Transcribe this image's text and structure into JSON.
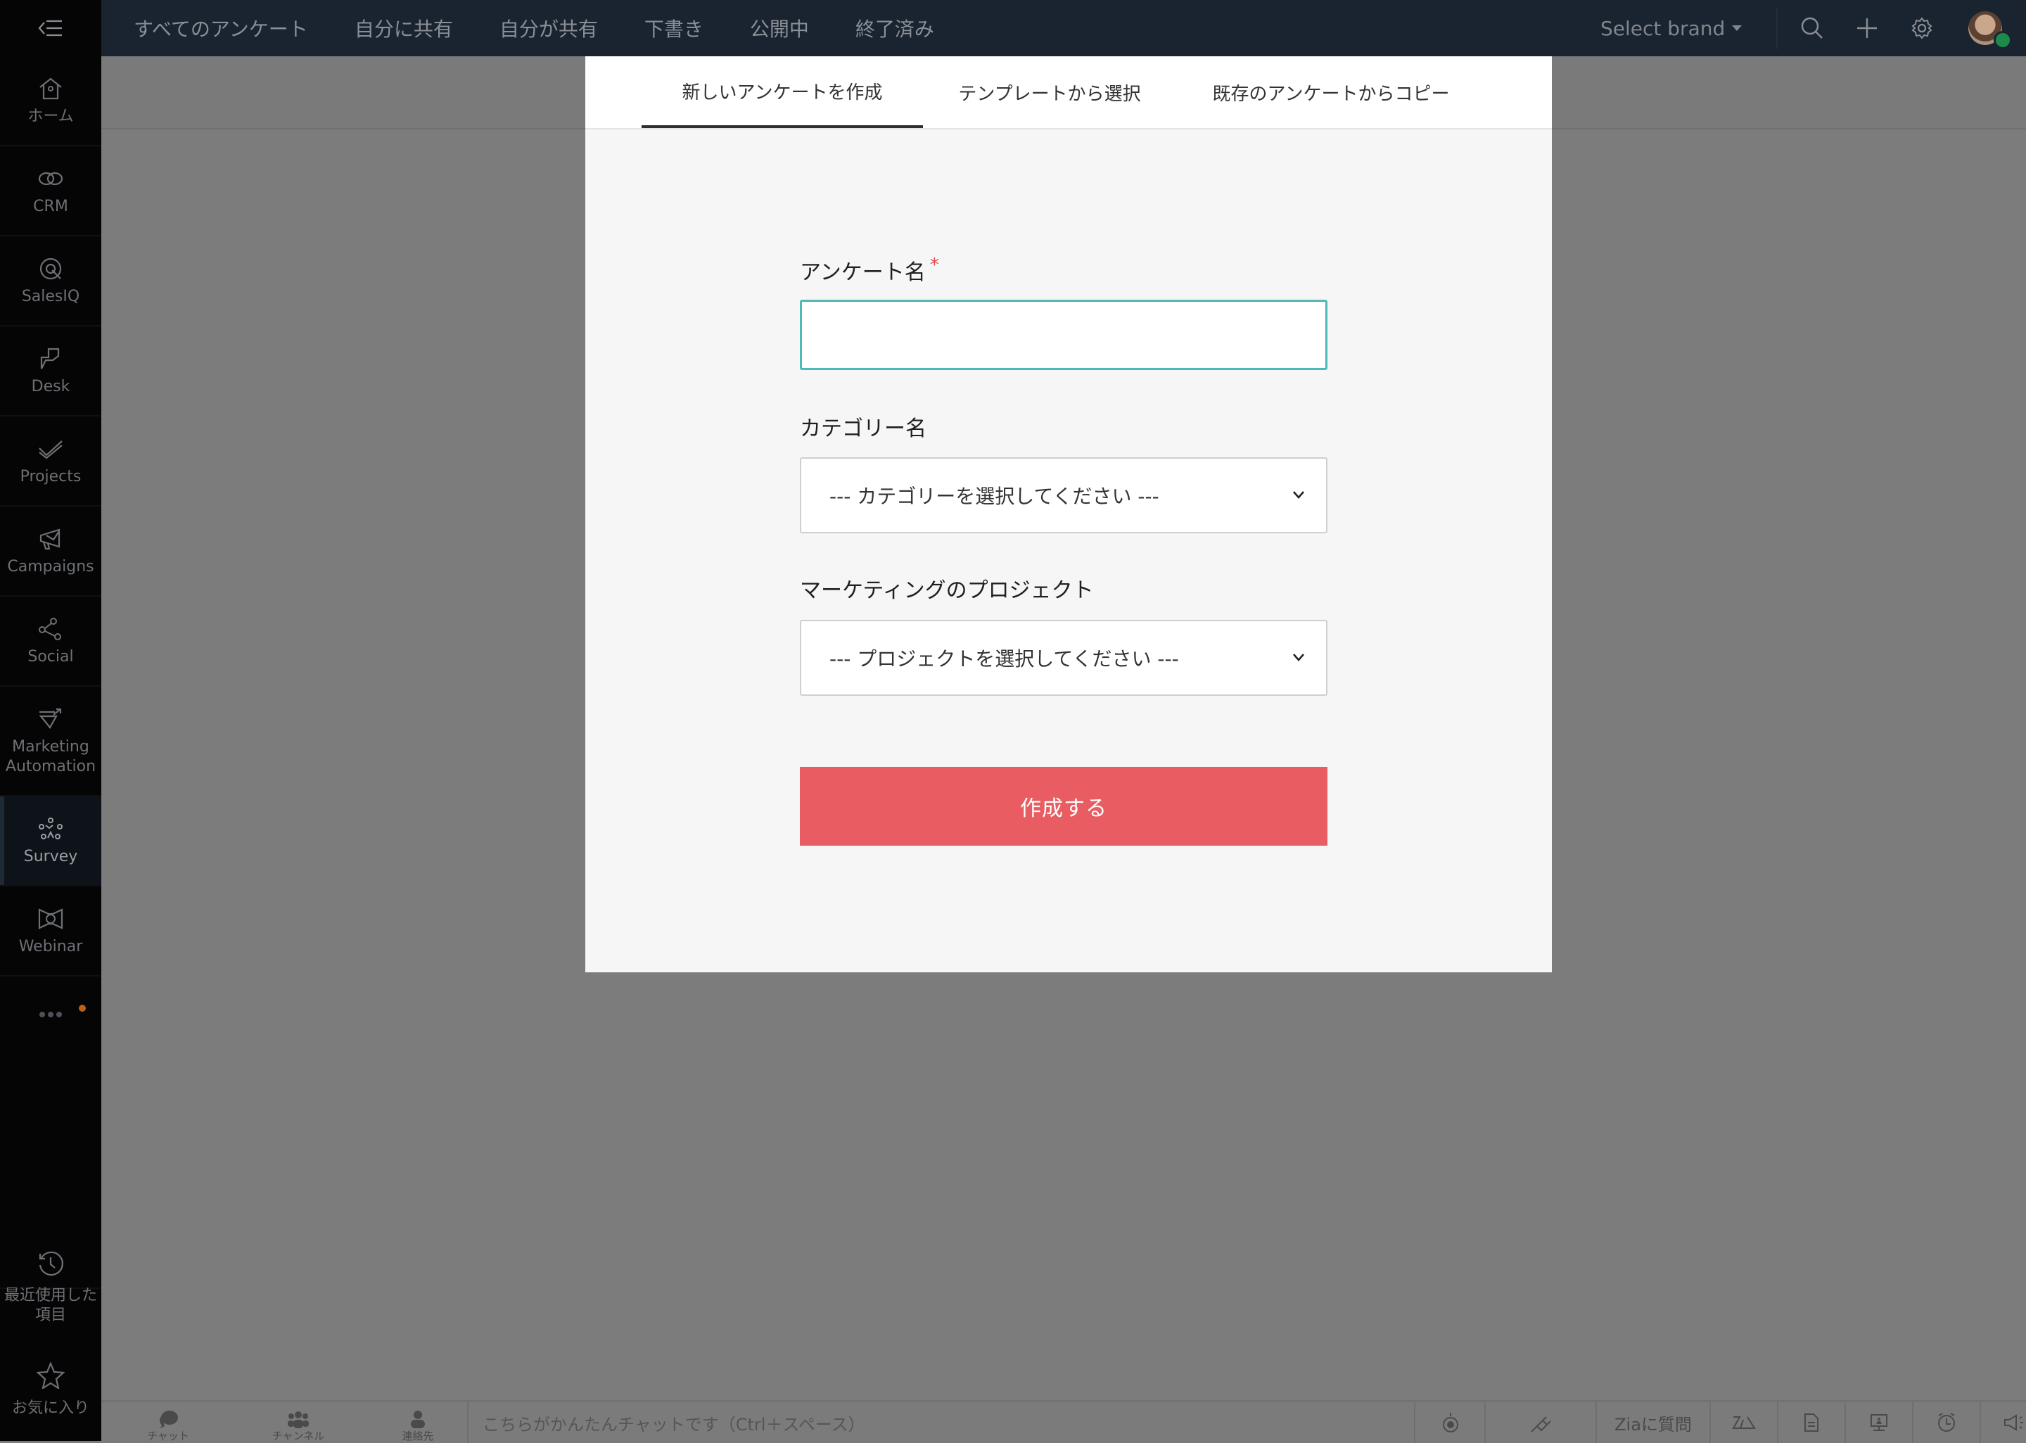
{
  "topbar": {
    "nav": [
      "すべてのアンケート",
      "自分に共有",
      "自分が共有",
      "下書き",
      "公開中",
      "終了済み"
    ],
    "brand_select": "Select brand",
    "icons": [
      "search-icon",
      "add-icon",
      "settings-icon",
      "avatar"
    ]
  },
  "sidebar": {
    "items": [
      {
        "label": "ホーム",
        "icon": "home-icon"
      },
      {
        "label": "CRM",
        "icon": "crm-icon"
      },
      {
        "label": "SalesIQ",
        "icon": "salesiq-icon"
      },
      {
        "label": "Desk",
        "icon": "desk-icon"
      },
      {
        "label": "Projects",
        "icon": "projects-icon"
      },
      {
        "label": "Campaigns",
        "icon": "campaigns-icon"
      },
      {
        "label": "Social",
        "icon": "social-icon"
      },
      {
        "label": "Marketing Automation",
        "icon": "marketing-automation-icon"
      },
      {
        "label": "Survey",
        "icon": "survey-icon",
        "active": true
      },
      {
        "label": "Webinar",
        "icon": "webinar-icon"
      }
    ],
    "recent": "最近使用した項目",
    "favorites": "お気に入り"
  },
  "modal": {
    "tabs": [
      "新しいアンケートを作成",
      "テンプレートから選択",
      "既存のアンケートからコピー"
    ],
    "active_tab": 0,
    "survey_name_label": "アンケート名",
    "required_mark": "*",
    "survey_name_value": "",
    "category_label": "カテゴリー名",
    "category_selected": "--- カテゴリーを選択してください ---",
    "project_label": "マーケティングのプロジェクト",
    "project_selected": "--- プロジェクトを選択してください ---",
    "create_button": "作成する"
  },
  "bottombar": {
    "chat": "チャット",
    "channels": "チャンネル",
    "contacts": "連絡先",
    "chat_placeholder": "こちらがかんたんチャットです（Ctrl＋スペース）",
    "ask_zia": "Ziaに質問"
  },
  "colors": {
    "accent_button": "#e95d62",
    "input_focus": "#4fb8b8",
    "required": "#e2464c"
  }
}
